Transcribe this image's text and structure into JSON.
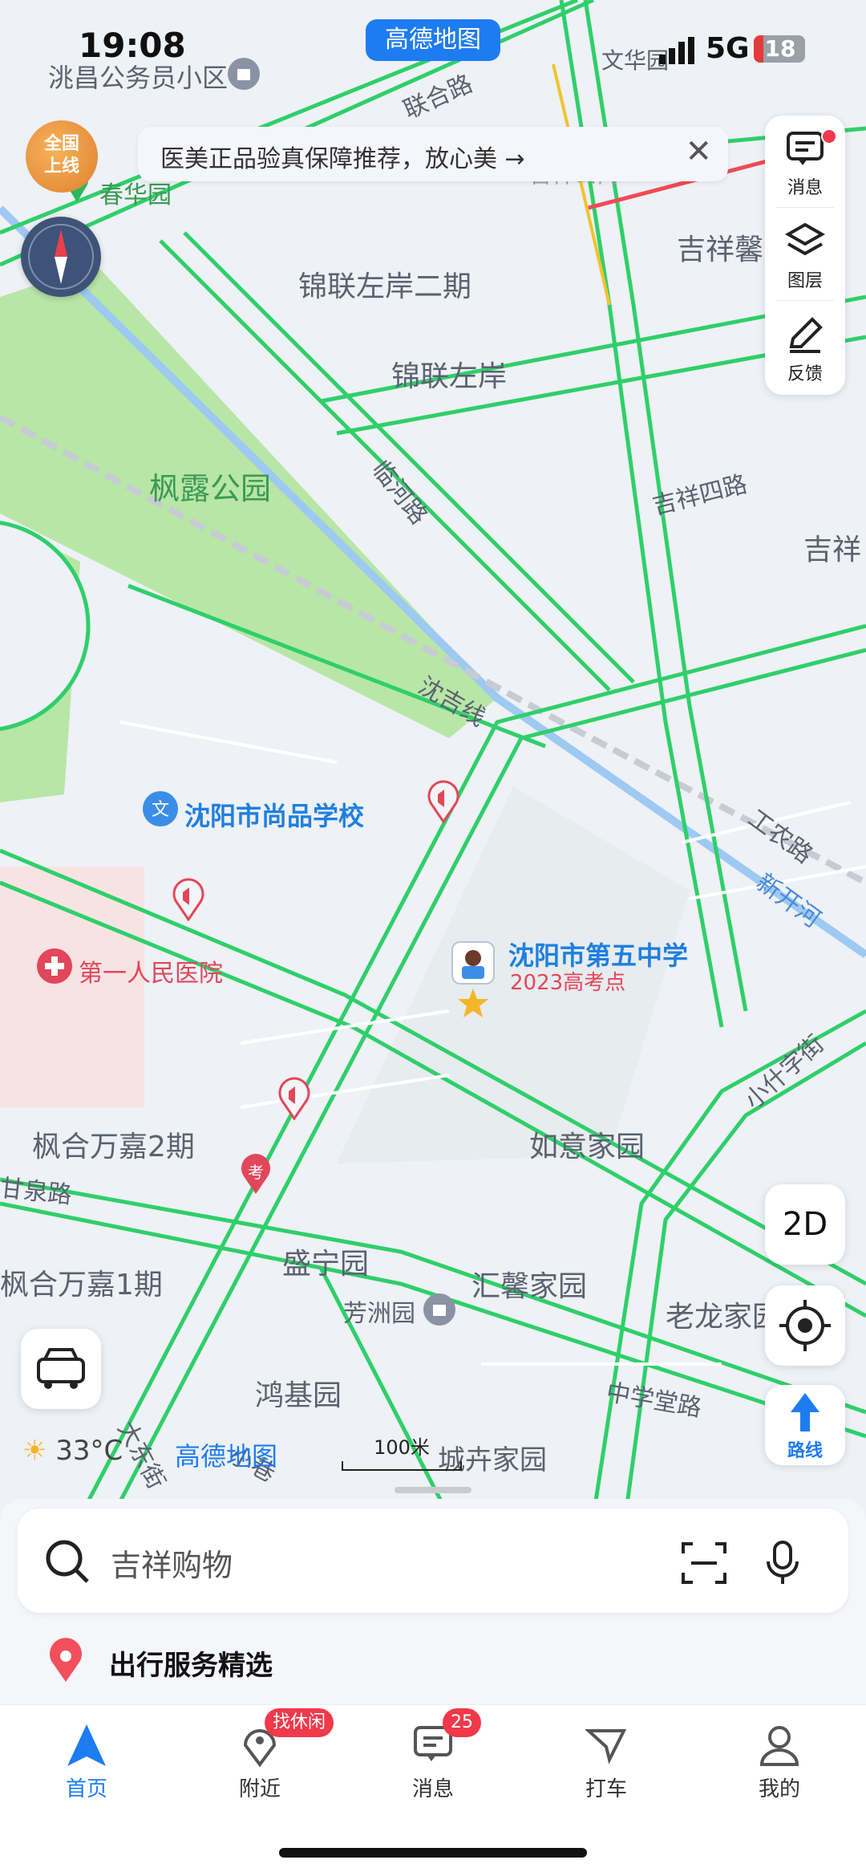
{
  "status_bar": {
    "time": "19:08",
    "network": "5G",
    "battery": "18"
  },
  "app_pill": "高德地图",
  "banner": {
    "text": "医美正品验真保障推荐，放心美 →"
  },
  "avatar_badge": "全国\n上线",
  "right_tools": [
    {
      "label": "消息",
      "icon": "message-icon"
    },
    {
      "label": "图层",
      "icon": "layers-icon"
    },
    {
      "label": "反馈",
      "icon": "edit-icon"
    }
  ],
  "map": {
    "places": [
      "洮昌公务员小区",
      "春华园",
      "锦联左岸二期",
      "锦联左岸",
      "枫露公园",
      "吉祥馨",
      "吉祥",
      "文华园",
      "吉祥公寓",
      "沈阳市尚品学校",
      "第一人民医院",
      "沈阳市第五中学",
      "2023高考点",
      "如意家园",
      "枫合万嘉2期",
      "枫合万嘉1期",
      "盛宁园",
      "汇馨家园",
      "芳洲园",
      "老龙家园",
      "鸿基园",
      "城卉家园"
    ],
    "roads": [
      "联合路",
      "临河路",
      "吉祥四路",
      "沈吉线",
      "工农路",
      "新开河",
      "小什字街",
      "甘泉路",
      "中学堂路",
      "大东街",
      "小巷"
    ]
  },
  "floating": {
    "mode_2d": "2D",
    "route_label": "路线"
  },
  "weather": {
    "temp": "33°C"
  },
  "map_brand": "高德地图",
  "scale": "100米",
  "search": {
    "placeholder": "吉祥购物"
  },
  "service": {
    "label": "出行服务精选"
  },
  "tabs": [
    {
      "label": "首页",
      "icon": "navigation-arrow-icon",
      "active": true
    },
    {
      "label": "附近",
      "icon": "location-pin-icon",
      "badge": "找休闲"
    },
    {
      "label": "消息",
      "icon": "message-icon",
      "badge": "25"
    },
    {
      "label": "打车",
      "icon": "taxi-icon"
    },
    {
      "label": "我的",
      "icon": "profile-icon"
    }
  ],
  "colors": {
    "accent": "#1e7cf2",
    "road_green": "#2fcf6a",
    "park": "#b8e6a6",
    "river": "#9dc9f2",
    "alert": "#f0394a"
  }
}
